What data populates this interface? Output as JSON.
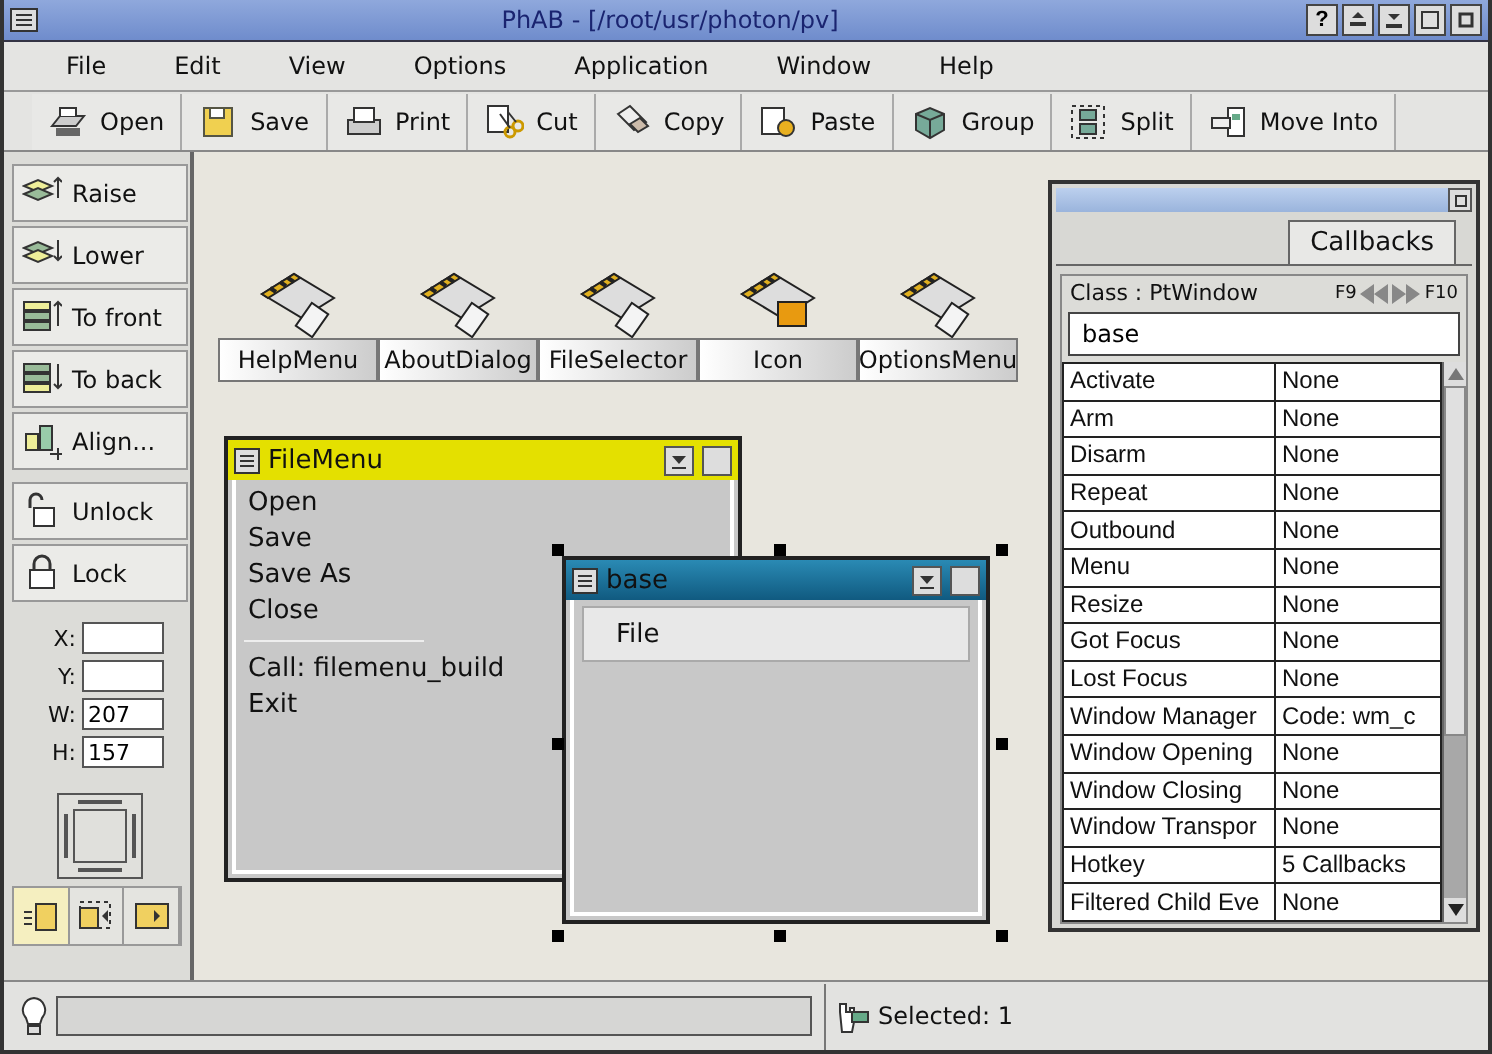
{
  "window": {
    "title": "PhAB - [/root/usr/photon/pv]",
    "help_button": "?"
  },
  "menu": [
    "File",
    "Edit",
    "View",
    "Options",
    "Application",
    "Window",
    "Help"
  ],
  "toolbar": [
    "Open",
    "Save",
    "Print",
    "Cut",
    "Copy",
    "Paste",
    "Group",
    "Split",
    "Move Into"
  ],
  "palette": {
    "buttons": [
      "Raise",
      "Lower",
      "To front",
      "To back",
      "Align...",
      "Unlock",
      "Lock"
    ],
    "fields": [
      {
        "label": "X:"
      },
      {
        "label": "Y:"
      },
      {
        "label": "W:",
        "value": "207"
      },
      {
        "label": "H:",
        "value": "157"
      }
    ],
    "mode_buttons": [
      {
        "selected": true
      },
      {
        "selected": false
      },
      {
        "selected": false
      }
    ]
  },
  "modules": [
    {
      "label": "HelpMenu"
    },
    {
      "label": "AboutDialog"
    },
    {
      "label": "FileSelector"
    },
    {
      "label": "Icon"
    },
    {
      "label": "OptionsMenu"
    }
  ],
  "windows": [
    {
      "title": "FileMenu",
      "kind": "menu",
      "selected": false,
      "items": [
        {
          "kind": "item",
          "label": "Open"
        },
        {
          "kind": "item",
          "label": "Save"
        },
        {
          "kind": "item",
          "label": "Save As"
        },
        {
          "kind": "item",
          "label": "Close"
        },
        {
          "kind": "separator"
        },
        {
          "kind": "item",
          "label": "Call: filemenu_build"
        },
        {
          "kind": "item",
          "label": "Exit"
        }
      ]
    },
    {
      "title": "base",
      "kind": "window",
      "selected": true,
      "items": [
        {
          "kind": "menubar",
          "label": "File"
        }
      ]
    }
  ],
  "callbacks_panel": {
    "tab": "Callbacks",
    "class_label": "Class : PtWindow",
    "prev_key": "F9",
    "next_key": "F10",
    "widget_name": "base",
    "rows": [
      {
        "name": "Activate",
        "value": "None"
      },
      {
        "name": "Arm",
        "value": "None"
      },
      {
        "name": "Disarm",
        "value": "None"
      },
      {
        "name": "Repeat",
        "value": "None"
      },
      {
        "name": "Outbound",
        "value": "None"
      },
      {
        "name": "Menu",
        "value": "None"
      },
      {
        "name": "Resize",
        "value": "None"
      },
      {
        "name": "Got Focus",
        "value": "None"
      },
      {
        "name": "Lost Focus",
        "value": "None"
      },
      {
        "name": "Window Manager",
        "value": "Code: wm_c"
      },
      {
        "name": "Window Opening",
        "value": "None"
      },
      {
        "name": "Window Closing",
        "value": "None"
      },
      {
        "name": "Window Transpor",
        "value": "None"
      },
      {
        "name": "Hotkey",
        "value": "5 Callbacks"
      },
      {
        "name": "Filtered Child Eve",
        "value": "None"
      }
    ]
  },
  "status_bar": {
    "selection": "Selected: 1"
  }
}
